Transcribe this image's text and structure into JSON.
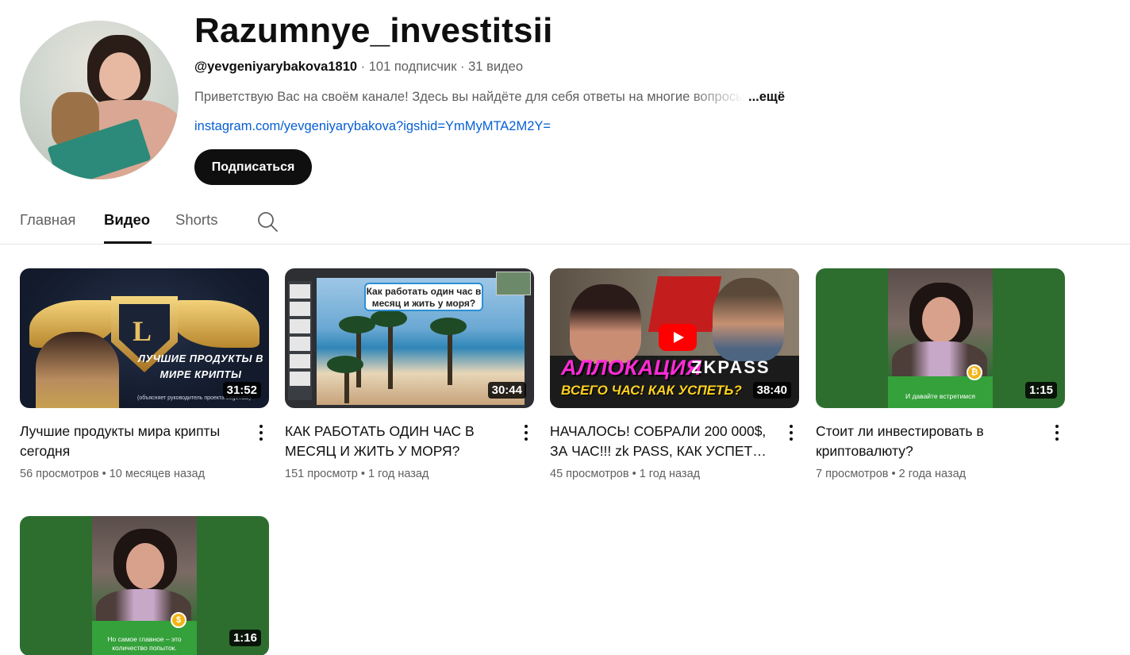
{
  "channel": {
    "title": "Razumnye_investitsii",
    "handle": "@yevgeniyarybakova1810",
    "stats": " · 101 подписчик · 31 видео",
    "description": "Приветствую Вас на своём канале! Здесь вы найдёте для себя ответы на многие вопросы",
    "more_label": "...ещё",
    "link": "instagram.com/yevgeniyarybakova?igshid=YmMyMTA2M2Y=",
    "subscribe_label": "Подписаться"
  },
  "tabs": [
    {
      "label": "Главная",
      "active": false
    },
    {
      "label": "Видео",
      "active": true
    },
    {
      "label": "Shorts",
      "active": false
    }
  ],
  "videos": [
    {
      "title": "Лучшие продукты мира крипты сегодня",
      "views": "56 просмотров",
      "age": "10 месяцев назад",
      "duration": "31:52",
      "thumb_text": "ЛУЧШИЕ ПРОДУКТЫ В МИРЕ КРИПТЫ",
      "thumb_small": "(объясняет руководитель проекта Legendal)",
      "thumb_letter": "L"
    },
    {
      "title": "КАК РАБОТАТЬ ОДИН ЧАС В МЕСЯЦ И ЖИТЬ У МОРЯ?",
      "views": "151 просмотр",
      "age": "1 год назад",
      "duration": "30:44",
      "thumb_text": "Как работать один час в месяц и жить у моря?"
    },
    {
      "title": "НАЧАЛОСЬ! СОБРАЛИ 200 000$, ЗА ЧАС!!! zk PASS, КАК УСПЕТЬ ...",
      "views": "45 просмотров",
      "age": "1 год назад",
      "duration": "38:40",
      "thumb_text": "АЛЛОКАЦИЯ",
      "thumb_brand": "ZKPASS",
      "thumb_sub": "ВСЕГО ЧАС! КАК УСПЕТЬ?"
    },
    {
      "title": "Стоит ли инвестировать в криптовалюту?",
      "views": "7 просмотров",
      "age": "2 года назад",
      "duration": "1:15",
      "thumb_text": "И давайте встретимся"
    },
    {
      "title": "",
      "views": "",
      "age": "",
      "duration": "1:16",
      "thumb_text": "Но самое главное – это количество попыток."
    }
  ],
  "separator": "•",
  "icons": {
    "search": "search-icon",
    "more": "more-vert-icon",
    "play": "youtube-play-icon",
    "coin": "dollar-coin-icon",
    "bitcoin": "bitcoin-coin-icon"
  },
  "colors": {
    "link": "#065fd4",
    "subscribe_bg": "#0f0f0f",
    "secondary_text": "#606060"
  }
}
